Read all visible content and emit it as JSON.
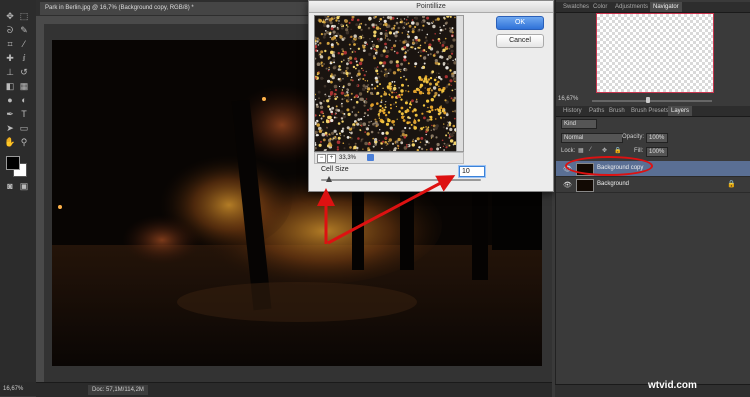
{
  "document": {
    "tab_title": "Park in Berlin.jpg @ 16,7% (Background copy, RGB/8) *"
  },
  "status": {
    "zoom": "16,67%",
    "doc_info": "Doc: 57,1M/114,2M"
  },
  "toolbar": {
    "icons": [
      "move-icon",
      "marquee-icon",
      "lasso-icon",
      "quick-select-icon",
      "crop-icon",
      "eyedropper-icon",
      "healing-icon",
      "brush-icon",
      "clone-stamp-icon",
      "history-brush-icon",
      "eraser-icon",
      "gradient-icon",
      "blur-icon",
      "dodge-icon",
      "pen-icon",
      "type-icon",
      "path-select-icon",
      "shape-icon",
      "hand-icon",
      "zoom-icon"
    ]
  },
  "dialog": {
    "title": "Pointillize",
    "ok_label": "OK",
    "cancel_label": "Cancel",
    "preview_zoom": "33,3%",
    "cell_size_label": "Cell Size",
    "cell_size_value": "10",
    "cell_size_slider_fraction": 0.05,
    "zoom_out_glyph": "−",
    "zoom_in_glyph": "+"
  },
  "panels": {
    "top_tabs": [
      "Swatches",
      "Color",
      "Adjustments",
      "Navigator"
    ],
    "active_top_tab": "Navigator",
    "navigator_zoom": "16,67%",
    "layer_tabs": [
      "History",
      "Paths",
      "Brush",
      "Brush Presets",
      "Layers"
    ],
    "active_layer_tab": "Layers",
    "filter_kind": "Kind",
    "blend_mode": "Normal",
    "opacity_label": "Opacity:",
    "opacity_value": "100%",
    "fill_label": "Fill:",
    "fill_value": "100%",
    "lock_label": "Lock:",
    "layers": [
      {
        "name": "Background copy",
        "selected": true,
        "locked": false
      },
      {
        "name": "Background",
        "selected": false,
        "locked": true
      }
    ]
  },
  "annotations": {
    "color": "#dd1111"
  },
  "watermark": "wtvid.com"
}
